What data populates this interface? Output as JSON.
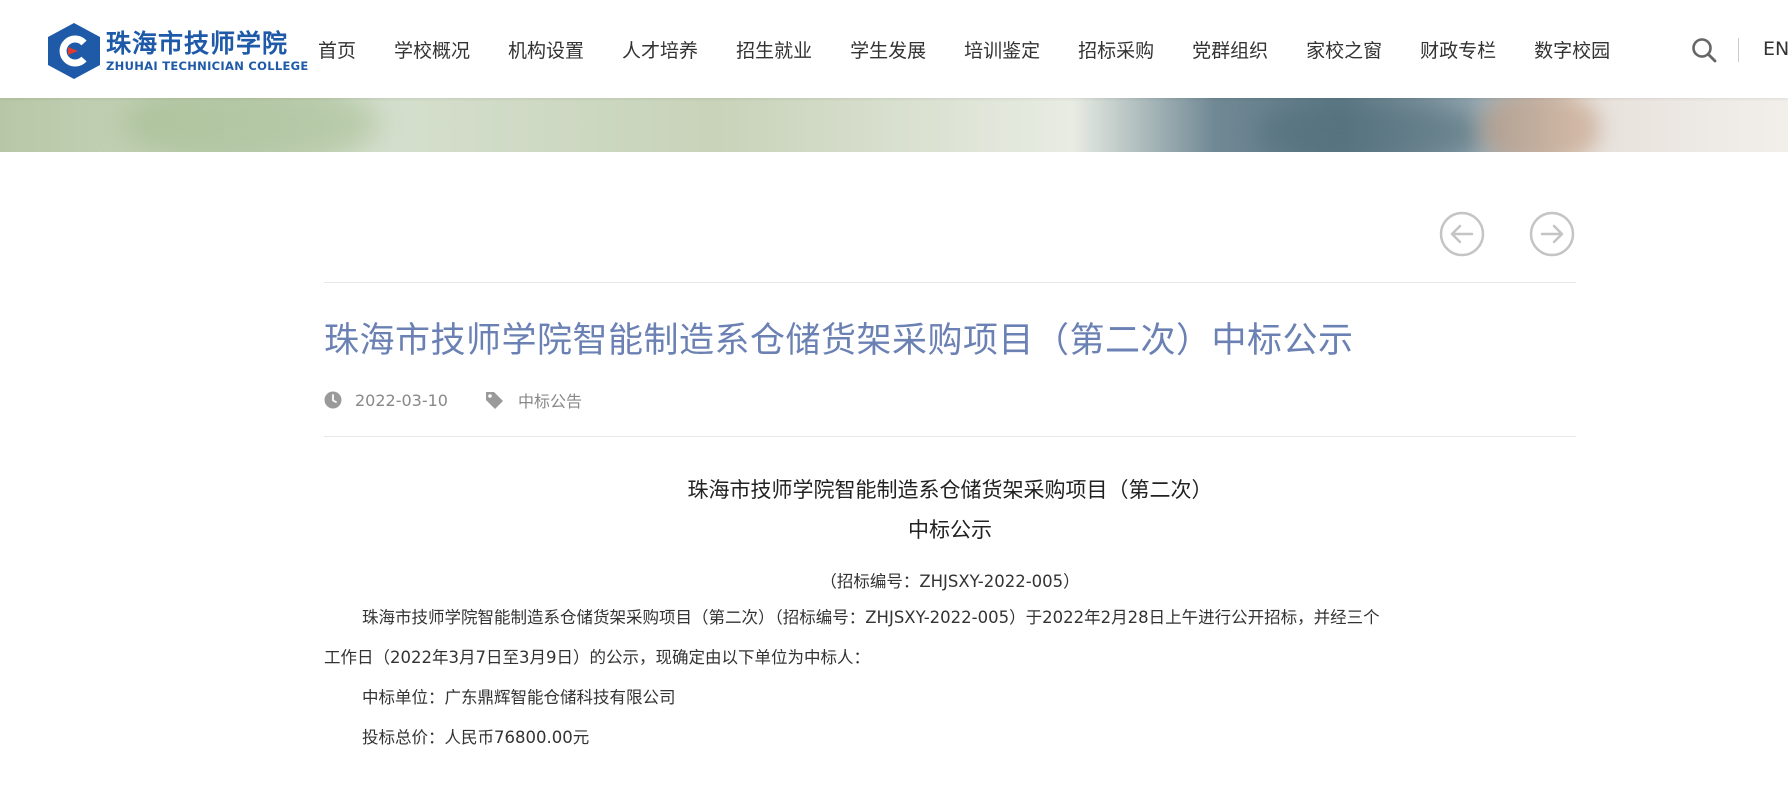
{
  "header": {
    "logo_cn": "珠海市技师学院",
    "logo_en": "ZHUHAI TECHNICIAN COLLEGE",
    "nav": [
      "首页",
      "学校概况",
      "机构设置",
      "人才培养",
      "招生就业",
      "学生发展",
      "培训鉴定",
      "招标采购",
      "党群组织",
      "家校之窗",
      "财政专栏",
      "数字校园"
    ],
    "lang": "EN",
    "brand_color": "#1e5aa8"
  },
  "article": {
    "title": "珠海市技师学院智能制造系仓储货架采购项目（第二次）中标公示",
    "date": "2022-03-10",
    "category": "中标公告",
    "title_color": "#6b81b4",
    "body": {
      "heading1": "珠海市技师学院智能制造系仓储货架采购项目（第二次）",
      "heading2": "中标公示",
      "number_line": "（招标编号：ZHJSXY-2022-005）",
      "para1_line1": "珠海市技师学院智能制造系仓储货架采购项目（第二次）（招标编号：ZHJSXY-2022-005）于2022年2月28日上午进行公开招标，并经三个",
      "para1_line2": "工作日（2022年3月7日至3月9日）的公示，现确定由以下单位为中标人：",
      "winner": "中标单位：广东鼎辉智能仓储科技有限公司",
      "price": "投标总价：人民币76800.00元"
    }
  }
}
